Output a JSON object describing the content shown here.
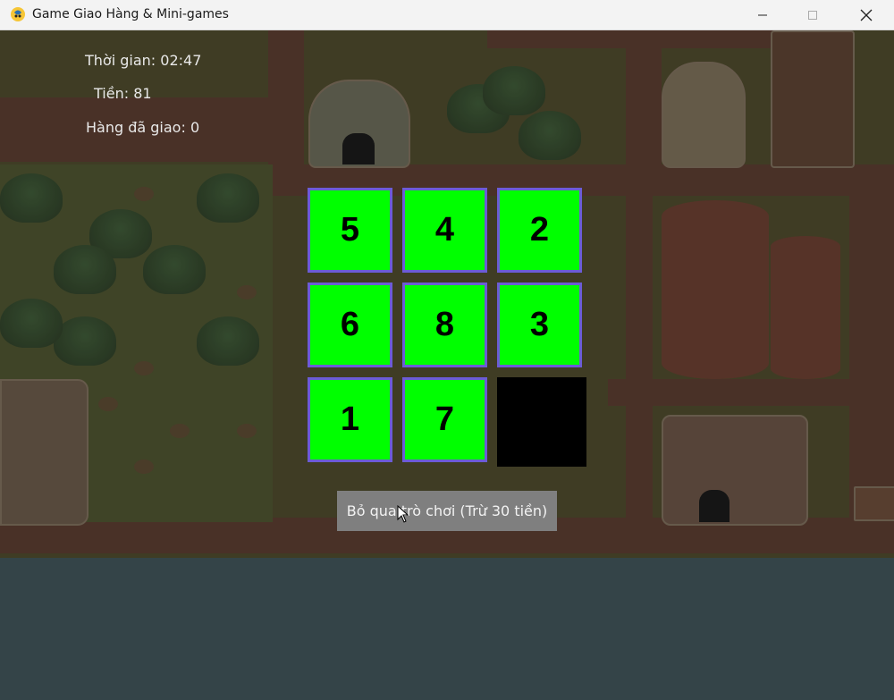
{
  "window": {
    "title": "Game Giao Hàng & Mini-games",
    "app_icon": "pygame-snake-icon",
    "controls": {
      "minimize": "minimize-icon",
      "maximize": "maximize-icon",
      "close": "close-icon"
    }
  },
  "hud": {
    "time": "Thời gian: 02:47",
    "money": "Tiền: 81",
    "delivered": "Hàng đã giao: 0"
  },
  "puzzle": {
    "tiles": [
      [
        "5",
        "4",
        "2"
      ],
      [
        "6",
        "8",
        "3"
      ],
      [
        "1",
        "7",
        ""
      ]
    ],
    "empty_cell": {
      "row": 2,
      "col": 2
    },
    "tile_color": "#00ff00",
    "tile_border_color": "#6b5cd6",
    "empty_color": "#000000"
  },
  "skip_button": {
    "label": "Bỏ qua trò chơi (Trừ 30 tiền)"
  }
}
